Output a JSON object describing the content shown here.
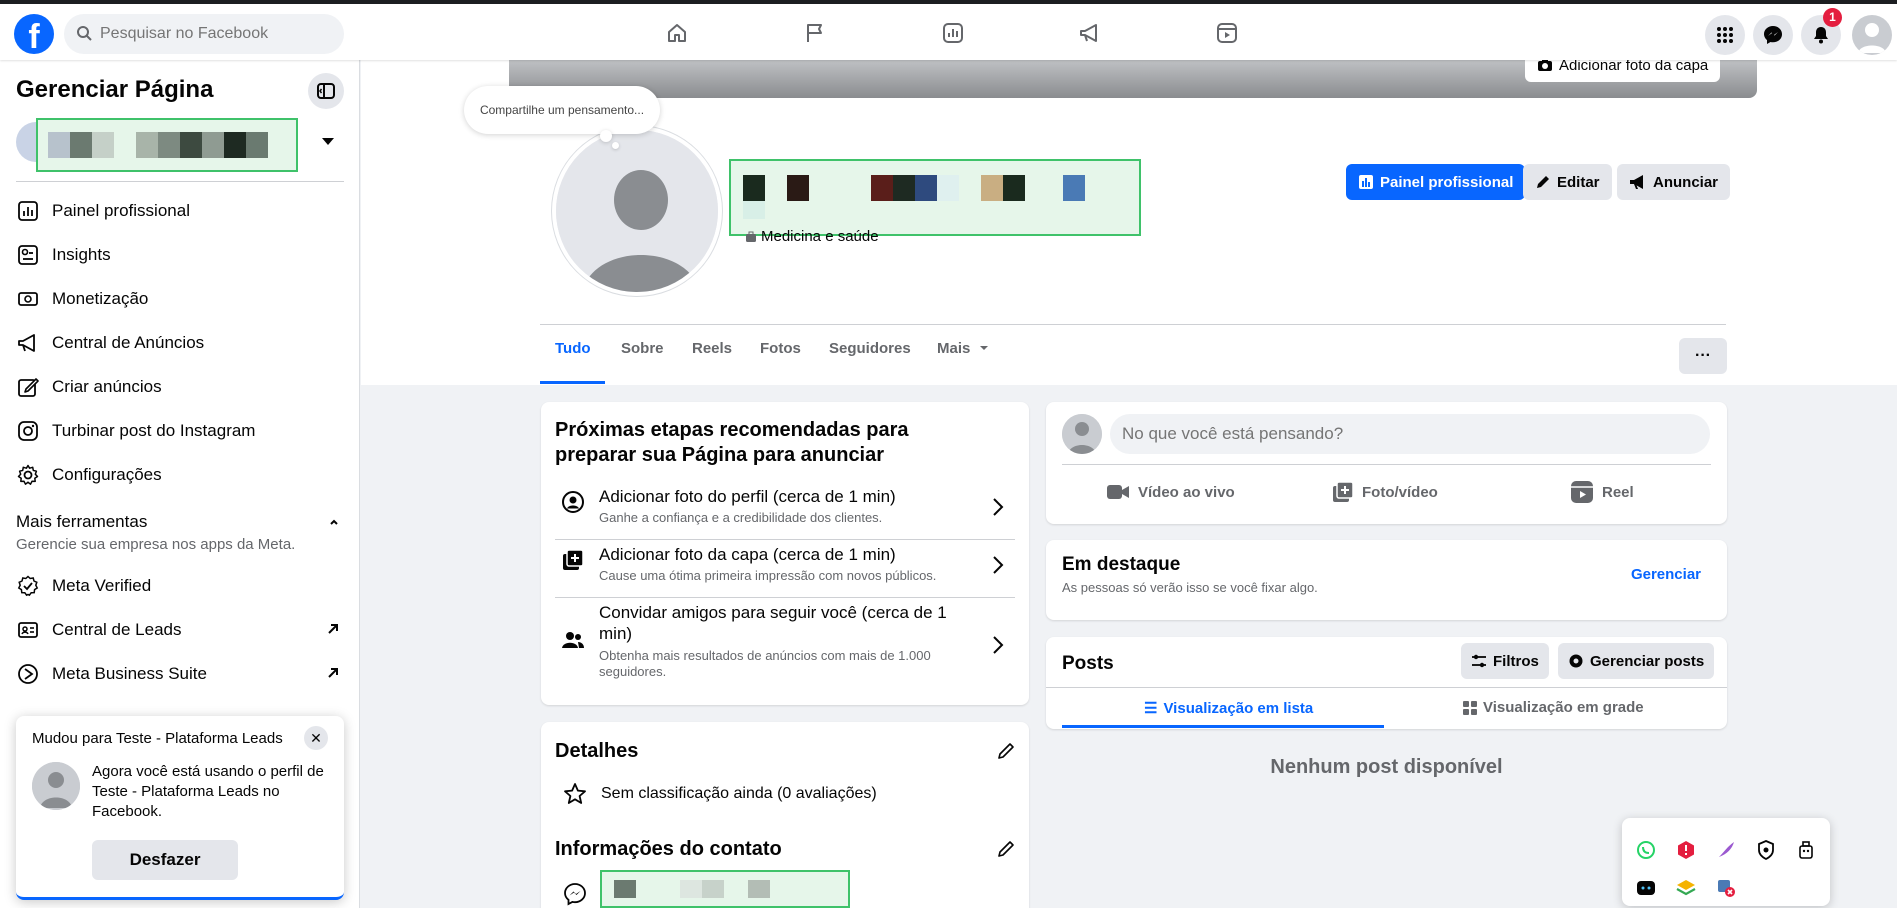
{
  "topbar": {
    "search_placeholder": "Pesquisar no Facebook",
    "notification_count": "1",
    "brand_color": "#0866ff"
  },
  "sidebar": {
    "title": "Gerenciar Página",
    "items": [
      {
        "label": "Painel profissional",
        "icon": "dashboard-icon"
      },
      {
        "label": "Insights",
        "icon": "insights-icon"
      },
      {
        "label": "Monetização",
        "icon": "money-icon"
      },
      {
        "label": "Central de Anúncios",
        "icon": "megaphone-icon"
      },
      {
        "label": "Criar anúncios",
        "icon": "pencil-icon"
      },
      {
        "label": "Turbinar post do Instagram",
        "icon": "instagram-icon"
      },
      {
        "label": "Configurações",
        "icon": "gear-icon"
      }
    ],
    "tools_heading": "Mais ferramentas",
    "tools_sub": "Gerencie sua empresa nos apps da Meta.",
    "tools": [
      {
        "label": "Meta Verified",
        "icon": "verified-icon"
      },
      {
        "label": "Central de Leads",
        "icon": "leads-icon"
      },
      {
        "label": "Meta Business Suite",
        "icon": "business-suite-icon"
      }
    ]
  },
  "toast": {
    "title": "Mudou para Teste - Plataforma Leads",
    "message": "Agora você está usando o perfil de Teste - Plataforma Leads no Facebook.",
    "undo_label": "Desfazer"
  },
  "header": {
    "cover_button": "Adicionar foto da capa",
    "thought_bubble": "Compartilhe um pensamento...",
    "category": "Medicina e saúde",
    "buttons": {
      "dashboard": "Painel profissional",
      "edit": "Editar",
      "advertise": "Anunciar"
    },
    "tabs": [
      "Tudo",
      "Sobre",
      "Reels",
      "Fotos",
      "Seguidores",
      "Mais"
    ],
    "active_tab": "Tudo"
  },
  "next_steps": {
    "title": "Próximas etapas recomendadas para preparar sua Página para anunciar",
    "steps": [
      {
        "title": "Adicionar foto do perfil (cerca de 1 min)",
        "desc": "Ganhe a confiança e a credibilidade dos clientes."
      },
      {
        "title": "Adicionar foto da capa (cerca de 1 min)",
        "desc": "Cause uma ótima primeira impressão com novos públicos."
      },
      {
        "title": "Convidar amigos para seguir você (cerca de 1 min)",
        "desc": "Obtenha mais resultados de anúncios com mais de 1.000 seguidores."
      }
    ]
  },
  "details": {
    "title": "Detalhes",
    "rating": "Sem classificação ainda (0 avaliações)",
    "contact_title": "Informações do contato"
  },
  "composer": {
    "placeholder": "No que você está pensando?",
    "actions": [
      "Vídeo ao vivo",
      "Foto/vídeo",
      "Reel"
    ]
  },
  "featured": {
    "title": "Em destaque",
    "subtitle": "As pessoas só verão isso se você fixar algo.",
    "manage": "Gerenciar"
  },
  "posts": {
    "title": "Posts",
    "filters": "Filtros",
    "manage": "Gerenciar posts",
    "list_view": "Visualização em lista",
    "grid_view": "Visualização em grade",
    "empty": "Nenhum post disponível"
  }
}
